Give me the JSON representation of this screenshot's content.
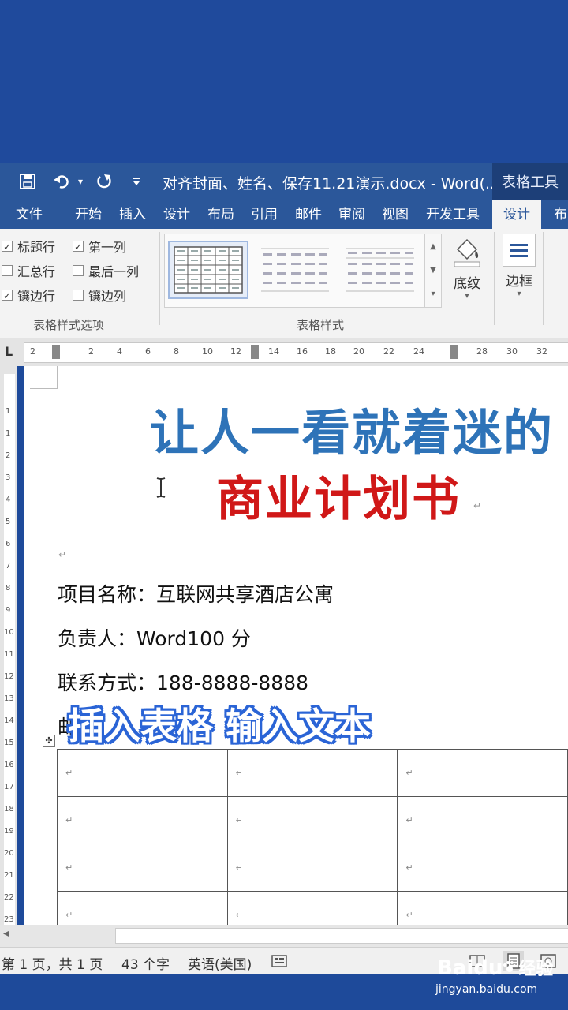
{
  "titlebar": {
    "document_title": "对齐封面、姓名、保存11.21演示.docx - Word(...",
    "contextual_tab": "表格工具",
    "more_glyph": "▾"
  },
  "tabs": [
    {
      "label": "文件"
    },
    {
      "label": "开始"
    },
    {
      "label": "插入"
    },
    {
      "label": "设计"
    },
    {
      "label": "布局"
    },
    {
      "label": "引用"
    },
    {
      "label": "邮件"
    },
    {
      "label": "审阅"
    },
    {
      "label": "视图"
    },
    {
      "label": "开发工具"
    },
    {
      "label": "设计",
      "active": true
    },
    {
      "label": "布"
    }
  ],
  "ribbon": {
    "style_options": {
      "group_label": "表格样式选项",
      "items": [
        {
          "label": "标题行",
          "checked": true
        },
        {
          "label": "第一列",
          "checked": true
        },
        {
          "label": "汇总行",
          "checked": false
        },
        {
          "label": "最后一列",
          "checked": false
        },
        {
          "label": "镶边行",
          "checked": true
        },
        {
          "label": "镶边列",
          "checked": false
        }
      ]
    },
    "table_styles": {
      "group_label": "表格样式"
    },
    "shading_label": "底纹",
    "borders_label": "边框"
  },
  "ruler": {
    "marks": [
      "2",
      "2",
      "4",
      "6",
      "8",
      "10",
      "12",
      "14",
      "16",
      "18",
      "20",
      "22",
      "24",
      "28",
      "30",
      "32"
    ],
    "corner": "L"
  },
  "vruler": {
    "marks": [
      "1",
      "1",
      "2",
      "3",
      "4",
      "5",
      "6",
      "7",
      "8",
      "9",
      "10",
      "11",
      "12",
      "13",
      "14",
      "15",
      "16",
      "17",
      "18",
      "19",
      "20",
      "21",
      "22",
      "23"
    ]
  },
  "document": {
    "heading1": "让人一看就着迷的",
    "heading2": "商业计划书",
    "lines": [
      "项目名称：互联网共享酒店公寓",
      "负责人：Word100 分",
      "联系方式：188-8888-8888",
      "邮"
    ],
    "para_mark": "↵",
    "anchor": "✣"
  },
  "caption": "插入表格 输入文本",
  "table": {
    "rows": 4,
    "cols": 3,
    "cell_mark": "↵"
  },
  "status": {
    "page": "第 1 页，共 1 页",
    "words": "43 个字",
    "language": "英语(美国)"
  },
  "watermark": {
    "brand": "Baidu",
    "brand_cn": "经验",
    "url": "jingyan.baidu.com"
  },
  "colors": {
    "accent": "#2b579a",
    "heading_blue": "#2e73b8",
    "heading_red": "#d01818"
  }
}
